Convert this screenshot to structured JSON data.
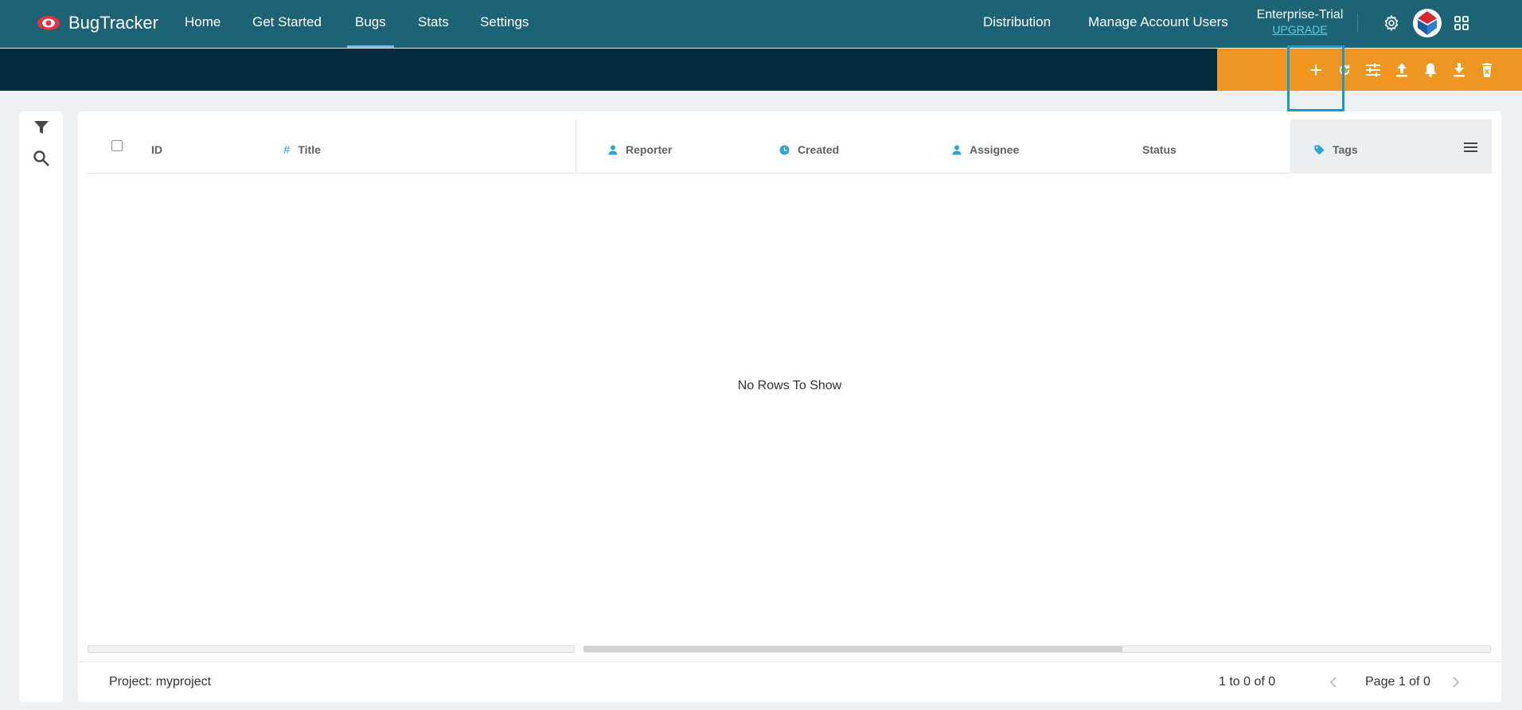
{
  "app": {
    "name": "BugTracker"
  },
  "nav": {
    "items": [
      {
        "label": "Home",
        "active": false
      },
      {
        "label": "Get Started",
        "active": false
      },
      {
        "label": "Bugs",
        "active": true
      },
      {
        "label": "Stats",
        "active": false
      },
      {
        "label": "Settings",
        "active": false
      }
    ],
    "right": [
      {
        "label": "Distribution"
      },
      {
        "label": "Manage Account Users"
      }
    ],
    "plan": {
      "name": "Enterprise-Trial",
      "upgrade": "UPGRADE"
    },
    "icons": [
      "gear-icon",
      "avatar-logo",
      "apps-grid-icon"
    ]
  },
  "toolbar": {
    "actions": [
      "add-icon",
      "refresh-icon",
      "customize-columns-icon",
      "upload-icon",
      "notification-bell-icon",
      "download-icon",
      "delete-icon"
    ],
    "highlighted": "add-icon"
  },
  "rail": {
    "icons": [
      "filter-icon",
      "search-icon"
    ]
  },
  "grid": {
    "columns": [
      {
        "label": "ID",
        "icon": ""
      },
      {
        "label": "Title",
        "icon": "hash-icon"
      },
      {
        "label": "Reporter",
        "icon": "person-icon"
      },
      {
        "label": "Created",
        "icon": "clock-icon"
      },
      {
        "label": "Assignee",
        "icon": "person-icon"
      },
      {
        "label": "Status",
        "icon": ""
      },
      {
        "label": "Tags",
        "icon": "tag-icon"
      }
    ],
    "rows": [],
    "empty_message": "No Rows To Show"
  },
  "footer": {
    "project": "Project: myproject",
    "range": "1 to 0 of 0",
    "page": "Page 1 of 0"
  },
  "colors": {
    "topbar": "#1c6475",
    "subbar": "#032c40",
    "actionbar": "#f0951f",
    "accent": "#139ad6",
    "column_icon": "#2aa3d8"
  }
}
